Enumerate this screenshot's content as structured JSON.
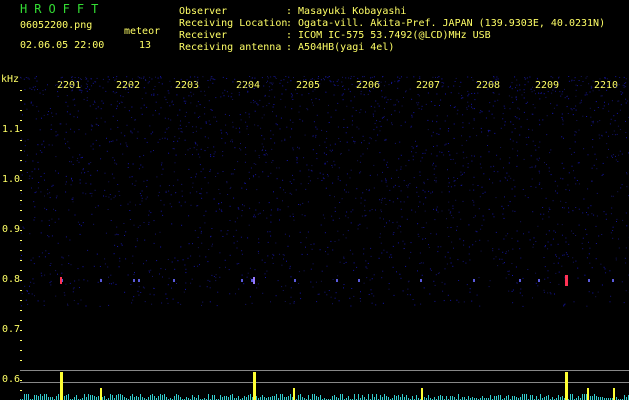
{
  "header": {
    "brand": "HROFFT",
    "filename": "06052200.png",
    "datetime": "02.06.05 22:00",
    "meteor_label": "meteor",
    "meteor_count": "13"
  },
  "station": {
    "observer_label": "Observer",
    "observer_value": ": Masayuki Kobayashi",
    "location_label": "Receiving Location",
    "location_value": ": Ogata-vill. Akita-Pref. JAPAN (139.9303E, 40.0231N)",
    "receiver_label": "Receiver",
    "receiver_value": ": ICOM IC-575 53.7492(@LCD)MHz USB",
    "antenna_label": "Receiving antenna",
    "antenna_value": ": A504HB(yagi 4el)"
  },
  "axes": {
    "y_unit": "kHz",
    "y_ticks": [
      "1.1",
      "1.0",
      "0.9",
      "0.8",
      "0.7",
      "0.6"
    ],
    "x_ticks": [
      "2201",
      "2202",
      "2203",
      "2204",
      "2205",
      "2206",
      "2207",
      "2208",
      "2209",
      "2210"
    ]
  },
  "colors": {
    "background": "#000000",
    "text": "#ffff66",
    "brand": "#33dd33",
    "noise": "#1a1a8c",
    "meteor": "#ff3355",
    "level_peak": "#ffff33",
    "level_base": "#33cccc"
  }
}
